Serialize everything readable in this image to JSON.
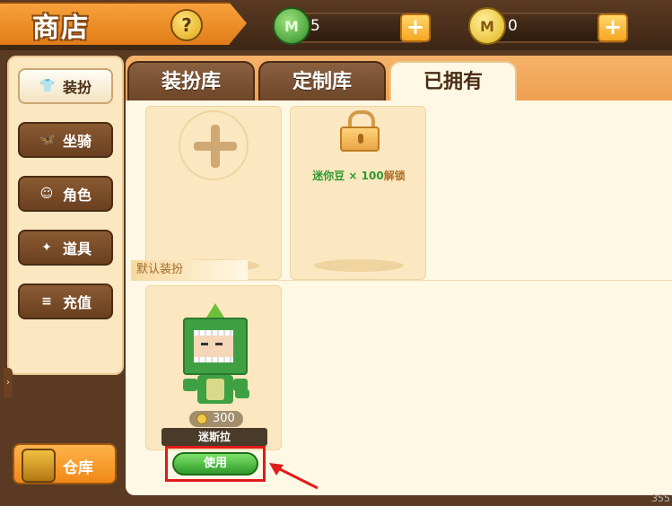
{
  "header": {
    "title": "商店",
    "help_icon_glyph": "?",
    "green_currency": {
      "icon_letter": "M",
      "value": "5",
      "plus": "+"
    },
    "gold_currency": {
      "icon_letter": "M",
      "value": "0",
      "plus": "+"
    }
  },
  "sidebar": {
    "items": [
      {
        "label": "装扮",
        "icon": "shirt-icon",
        "glyph": "👕",
        "active": true
      },
      {
        "label": "坐骑",
        "icon": "mount-icon",
        "glyph": "🦋",
        "active": false
      },
      {
        "label": "角色",
        "icon": "character-icon",
        "glyph": "☺",
        "active": false
      },
      {
        "label": "道具",
        "icon": "prop-icon",
        "glyph": "✦",
        "active": false
      },
      {
        "label": "充值",
        "icon": "coins-icon",
        "glyph": "≡",
        "active": false
      }
    ],
    "warehouse_label": "仓库",
    "collapse_arrow": "›"
  },
  "tabs": [
    {
      "label": "装扮库",
      "active": false
    },
    {
      "label": "定制库",
      "active": false
    },
    {
      "label": "已拥有",
      "active": true
    }
  ],
  "locked_card": {
    "item_text": "迷你豆 × 100",
    "action_text": "解锁"
  },
  "section": {
    "label": "默认装扮"
  },
  "skin_card": {
    "price": "300",
    "name": "迷斯拉",
    "use_label": "使用"
  },
  "corner_text": "355",
  "colors": {
    "accent_orange": "#f08818",
    "highlight_red": "#e01b1b",
    "use_green": "#2f9a2a"
  }
}
